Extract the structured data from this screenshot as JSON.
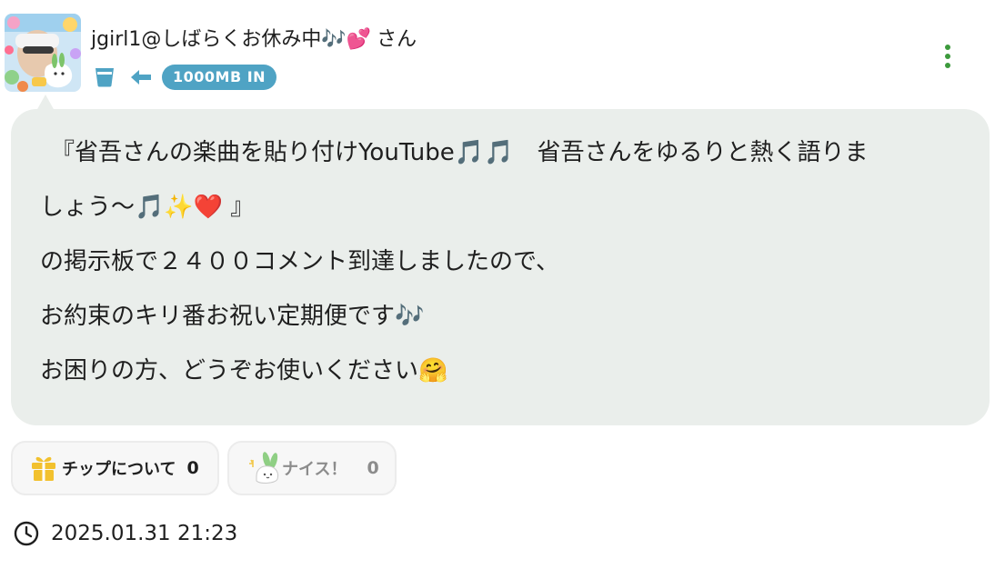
{
  "post": {
    "author": {
      "name": "jgirl1@しばらくお休み中🎶💕",
      "honorific": "さん",
      "avatar_icon": "user-avatar-photo"
    },
    "meta": {
      "cup_icon": "cup-icon",
      "arrow_icon": "arrow-left-icon",
      "badge": "1000MB IN"
    },
    "message": {
      "lines": [
        "『省吾さんの楽曲を貼り付けYouTube🎵🎵　省吾さんをゆるりと熱く語りま",
        "しょう〜🎵✨",
        "の掲示板で２４００コメント到達しましたので、",
        "お約束のキリ番お祝い定期便です🎶",
        "お困りの方、どうぞお使いください🤗"
      ],
      "line2_heart": "❤️",
      "line2_end": " 』"
    },
    "actions": {
      "tip": {
        "label": "チップについて",
        "count": "0",
        "icon": "gift-icon"
      },
      "nice": {
        "label": "ナイス！",
        "count": "0",
        "icon": "rabbit-nice-icon"
      }
    },
    "timestamp": "2025.01.31 21:23"
  },
  "colors": {
    "bubble_bg": "#eaeeeb",
    "badge_bg": "#4fa3c4",
    "icon_blue": "#4fa3c4",
    "more_dots": "#3c9a3c",
    "gift": "#f2c12e"
  }
}
